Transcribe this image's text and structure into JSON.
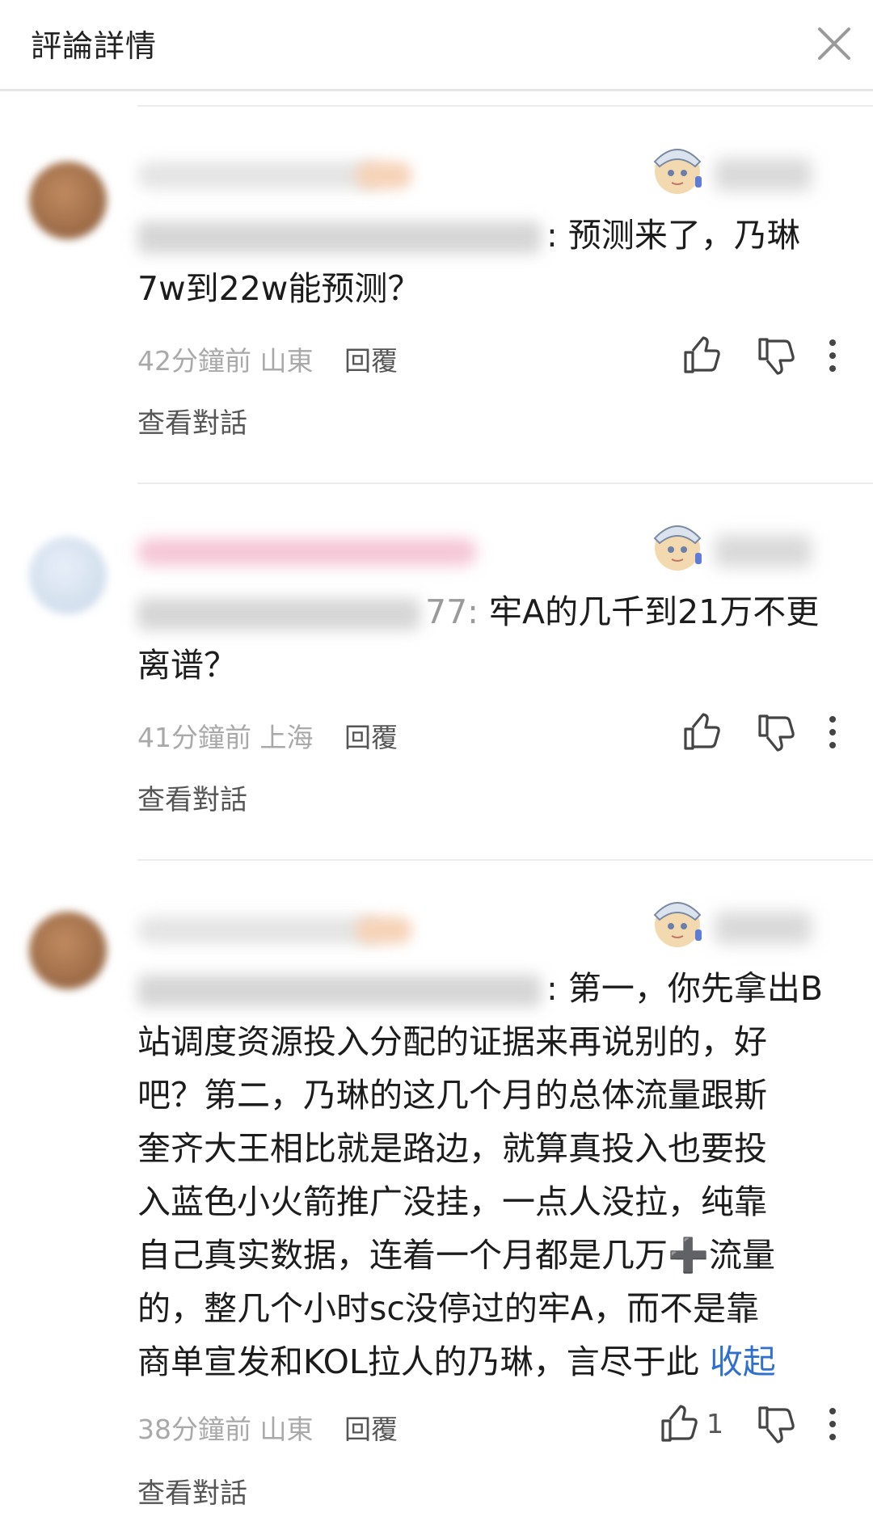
{
  "header": {
    "title": "評論詳情",
    "close_icon": "close-icon"
  },
  "comments": [
    {
      "text": "预测来了，乃琳7w到22w能预测？",
      "text_line1": "预测来了，乃琳",
      "text_line2": "7w到22w能预测？",
      "time": "42分鐘前",
      "location": "山東",
      "reply_label": "回覆",
      "like_count": "",
      "view_conversation": "查看對話"
    },
    {
      "ref_suffix": "77:",
      "text_line1": "牢A的几千到21万不更",
      "text_line2": "离谱？",
      "time": "41分鐘前",
      "location": "上海",
      "reply_label": "回覆",
      "like_count": "",
      "view_conversation": "查看對話"
    },
    {
      "lines": [
        "第一，你先拿出B",
        "站调度资源投入分配的证据来再说别的，好",
        "吧？第二，乃琳的这几个月的总体流量跟斯",
        "奎齐大王相比就是路边，就算真投入也要投",
        "入蓝色小火箭推广没挂，一点人没拉，纯靠",
        "自己真实数据，连着一个月都是几万➕流量",
        "的，整几个小时sc没停过的牢A，而不是靠",
        "商单宣发和KOL拉人的乃琳，言尽于此"
      ],
      "collapse_label": "收起",
      "time": "38分鐘前",
      "location": "山東",
      "reply_label": "回覆",
      "like_count": "1",
      "view_conversation": "查看對話"
    }
  ],
  "colors": {
    "link": "#2f6fd0",
    "meta": "#a9a9a9"
  },
  "icons": [
    "close-icon",
    "thumb-up-icon",
    "thumb-down-icon",
    "more-vertical-icon",
    "fan-badge-icon"
  ]
}
